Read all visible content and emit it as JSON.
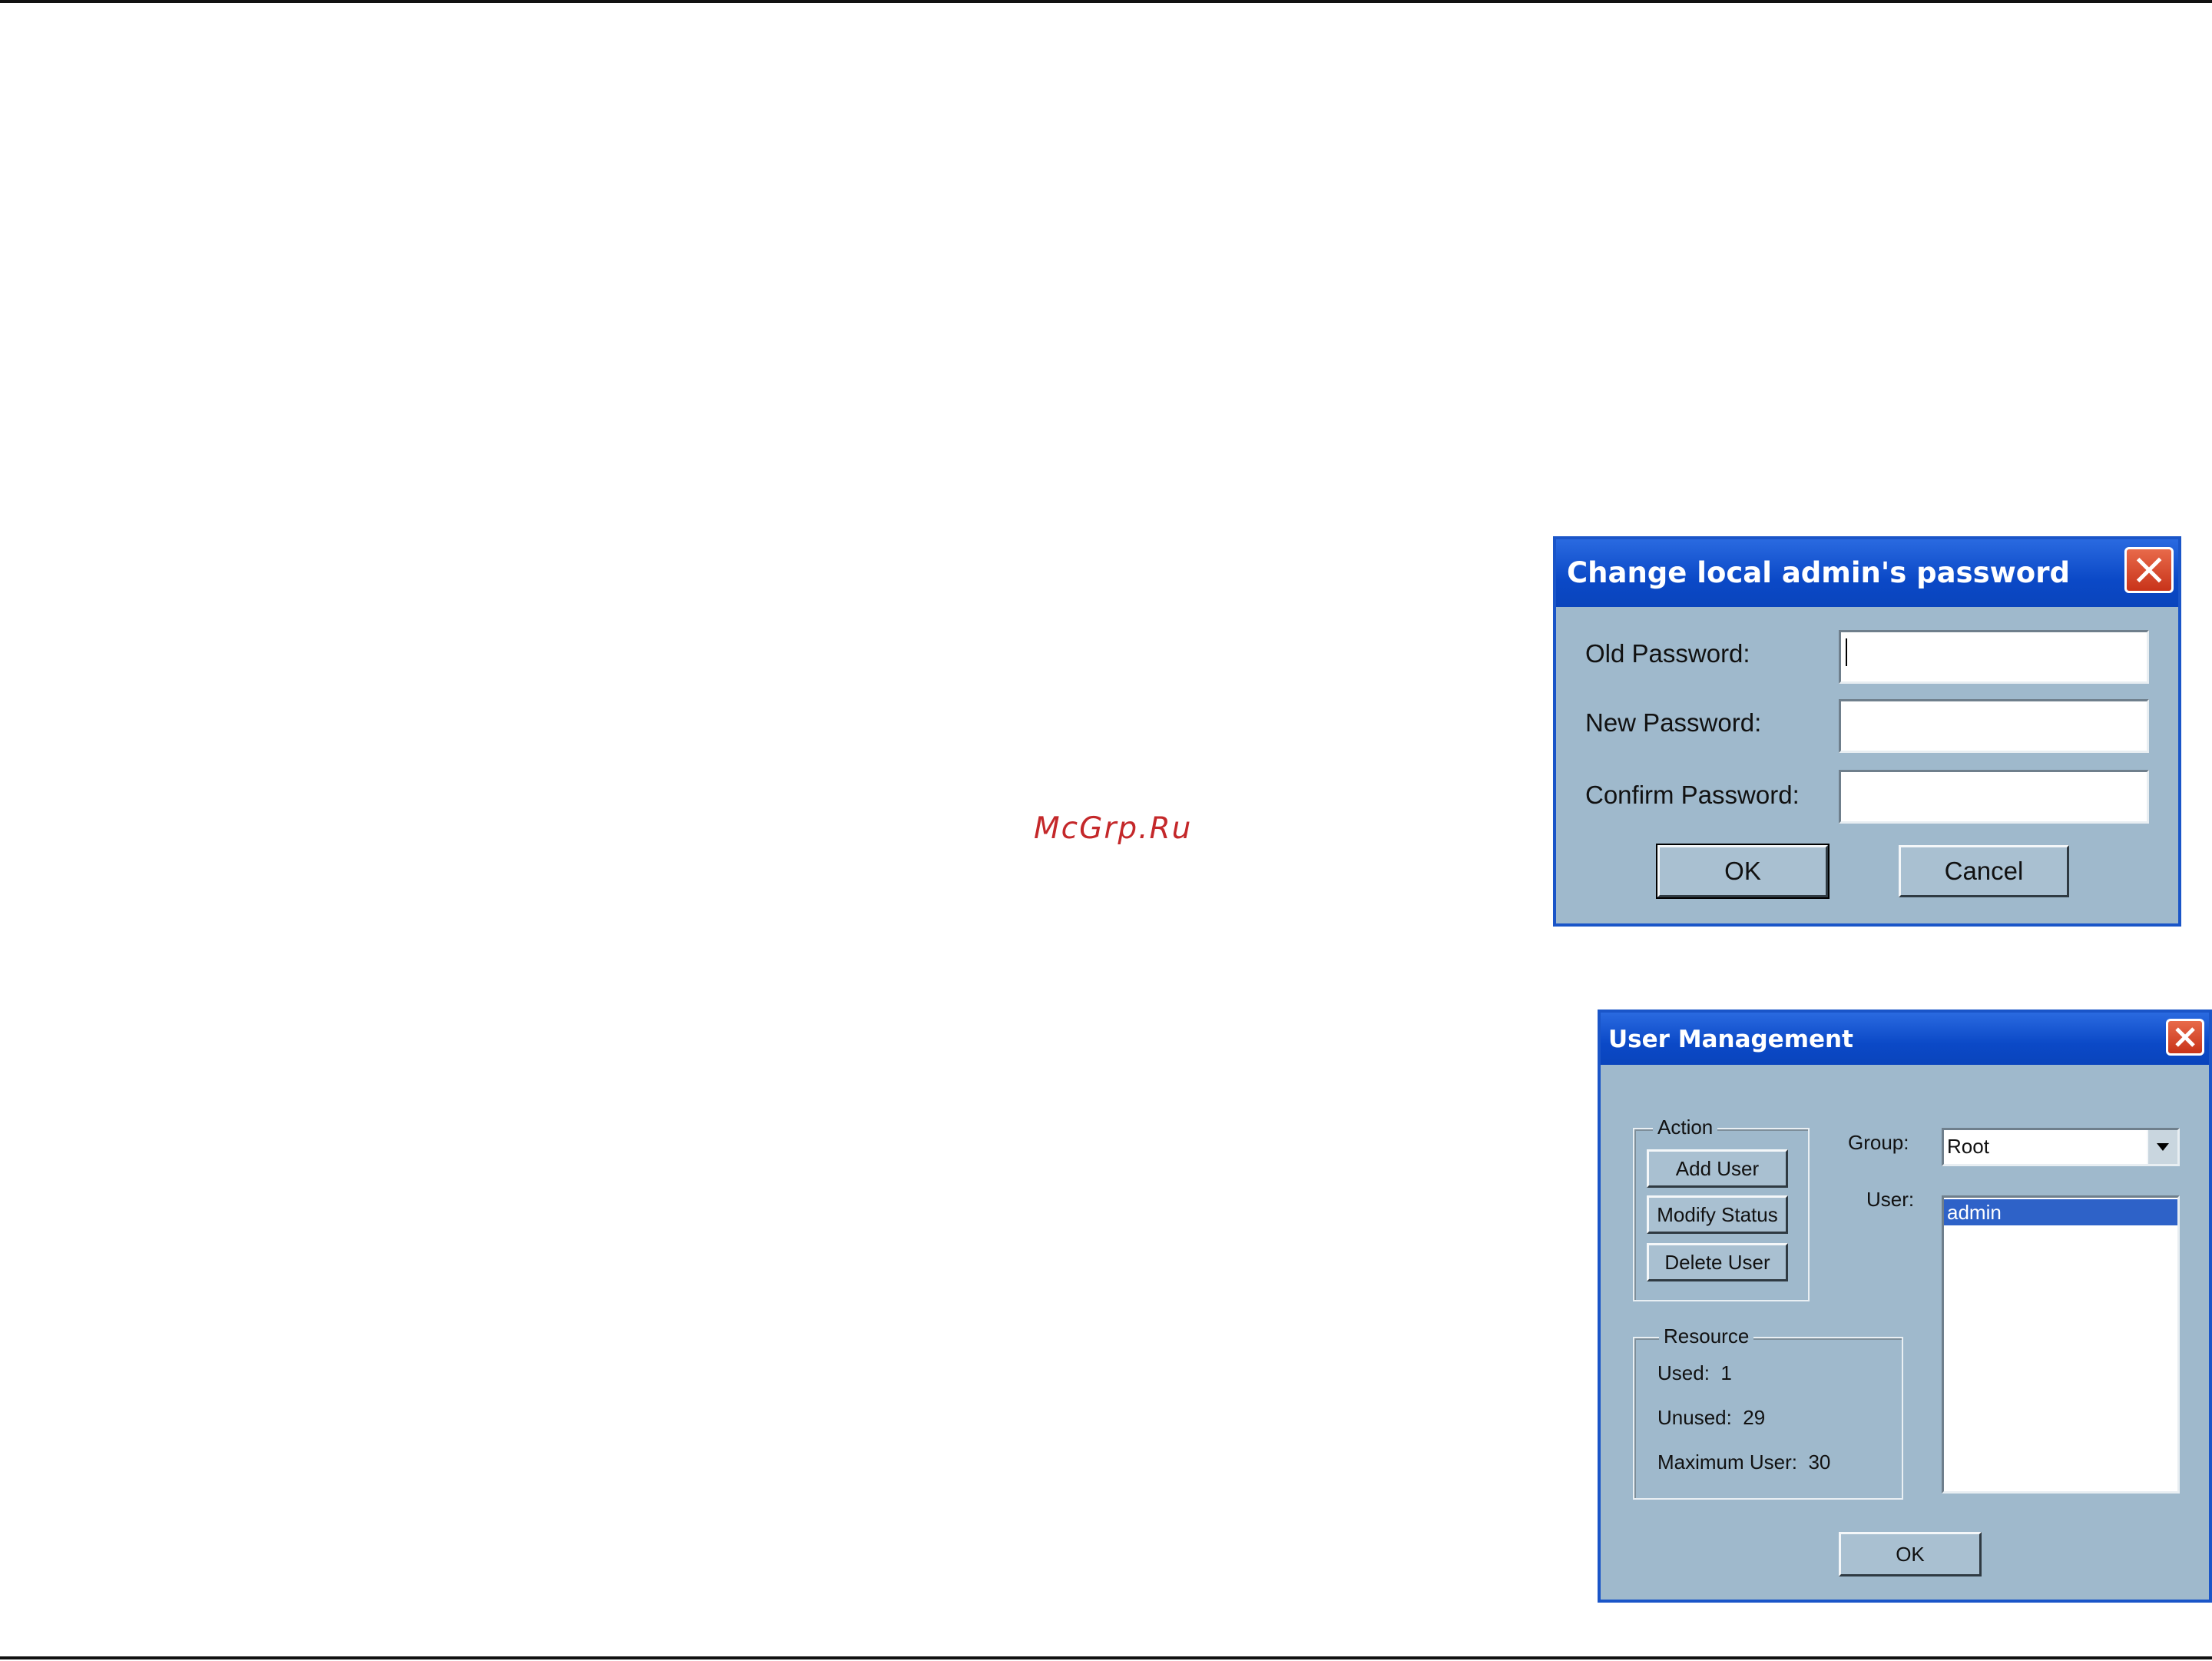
{
  "watermark": "McGrp.Ru",
  "password_dialog": {
    "title": "Change local admin's password",
    "old_label": "Old Password:",
    "new_label": "New Password:",
    "confirm_label": "Confirm Password:",
    "old_value": "",
    "new_value": "",
    "confirm_value": "",
    "ok_label": "OK",
    "cancel_label": "Cancel"
  },
  "user_dialog": {
    "title": "User Management",
    "action_group": "Action",
    "add_user_label": "Add User",
    "modify_status_label": "Modify Status",
    "delete_user_label": "Delete User",
    "resource_group": "Resource",
    "used_label": "Used:",
    "used_value": "1",
    "unused_label": "Unused:",
    "unused_value": "29",
    "max_label": "Maximum User:",
    "max_value": "30",
    "group_label": "Group:",
    "group_value": "Root",
    "user_label": "User:",
    "users": [
      "admin"
    ],
    "ok_label": "OK"
  },
  "colors": {
    "dialog_bg": "#9fb9cc",
    "titlebar": "#0b49c7",
    "selection": "#2e62c8",
    "close": "#d94a2a",
    "watermark": "#c4282a"
  }
}
